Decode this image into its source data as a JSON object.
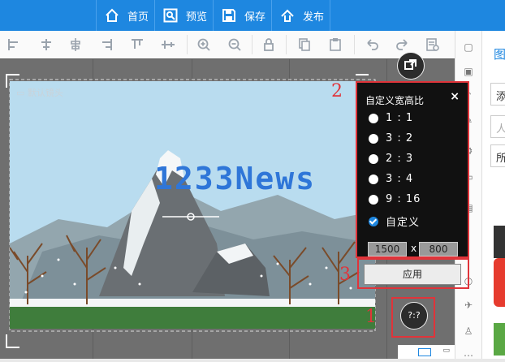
{
  "nav": {
    "home": "首页",
    "preview": "预览",
    "save": "保存",
    "publish": "发布"
  },
  "toolbar": {
    "icons": [
      "align-left-icon",
      "align-center-icon",
      "align-vertical-center-icon",
      "align-right-icon",
      "distribute-icon",
      "zoom-in-icon",
      "zoom-out-icon",
      "lock-icon",
      "copy-icon",
      "paste-icon",
      "undo-icon",
      "redo-icon",
      "settings-icon"
    ]
  },
  "canvas": {
    "camera_label": "默认镜头",
    "watermark": "1233News"
  },
  "popup": {
    "title": "自定义宽高比",
    "close": "×",
    "options": [
      "1 : 1",
      "3 : 2",
      "2 : 3",
      "3 : 4",
      "9 : 16",
      "自定义"
    ],
    "selected": "自定义",
    "width_value": "1500",
    "height_value": "800",
    "x_sep": "x",
    "apply_label": "应用"
  },
  "ratio_button": "?:?",
  "red_labels": {
    "one": "1",
    "two": "2",
    "three": "3"
  },
  "right_panel": {
    "header": "图",
    "rows": [
      "添",
      "人",
      "所"
    ]
  },
  "colors": {
    "brand_blue": "#1e87e0",
    "annotation_red": "#e0343a",
    "popup_bg": "#111111"
  }
}
